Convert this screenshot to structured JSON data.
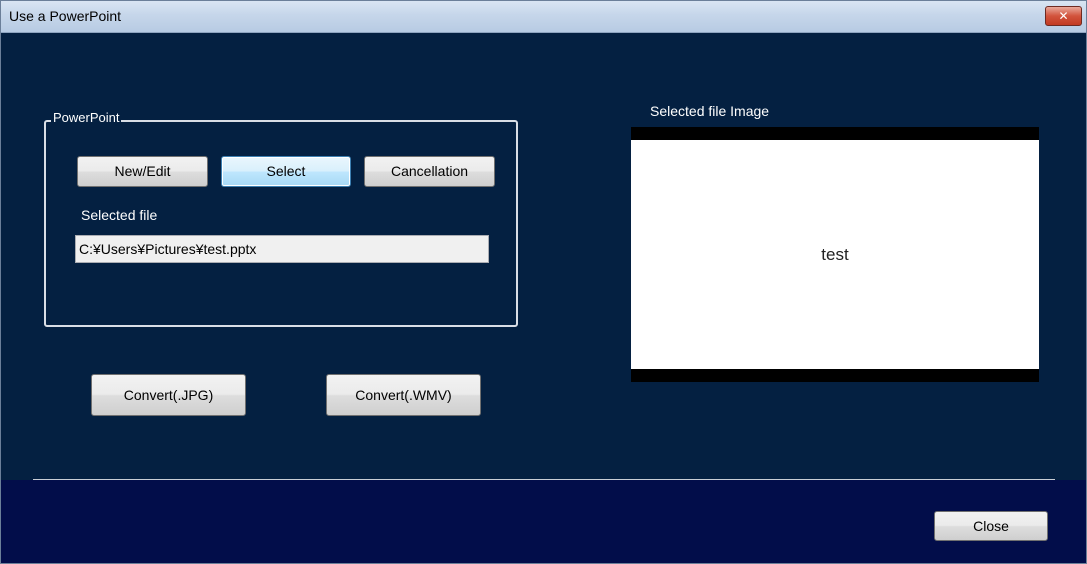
{
  "window": {
    "title": "Use a PowerPoint",
    "close_glyph": "✕"
  },
  "powerpoint_group": {
    "legend": "PowerPoint",
    "new_edit_label": "New/Edit",
    "select_label": "Select",
    "cancellation_label": "Cancellation",
    "selected_file_label": "Selected file",
    "selected_file_value": "C:¥Users¥Pictures¥test.pptx"
  },
  "convert": {
    "jpg_label": "Convert(.JPG)",
    "wmv_label": "Convert(.WMV)"
  },
  "preview": {
    "label": "Selected file Image",
    "slide_text": "test"
  },
  "footer": {
    "close_label": "Close"
  },
  "colors": {
    "panel_background": "#042041",
    "footer_background": "#020d4a",
    "titlebar": "#c6d6ea",
    "close_button": "#c13a22"
  }
}
